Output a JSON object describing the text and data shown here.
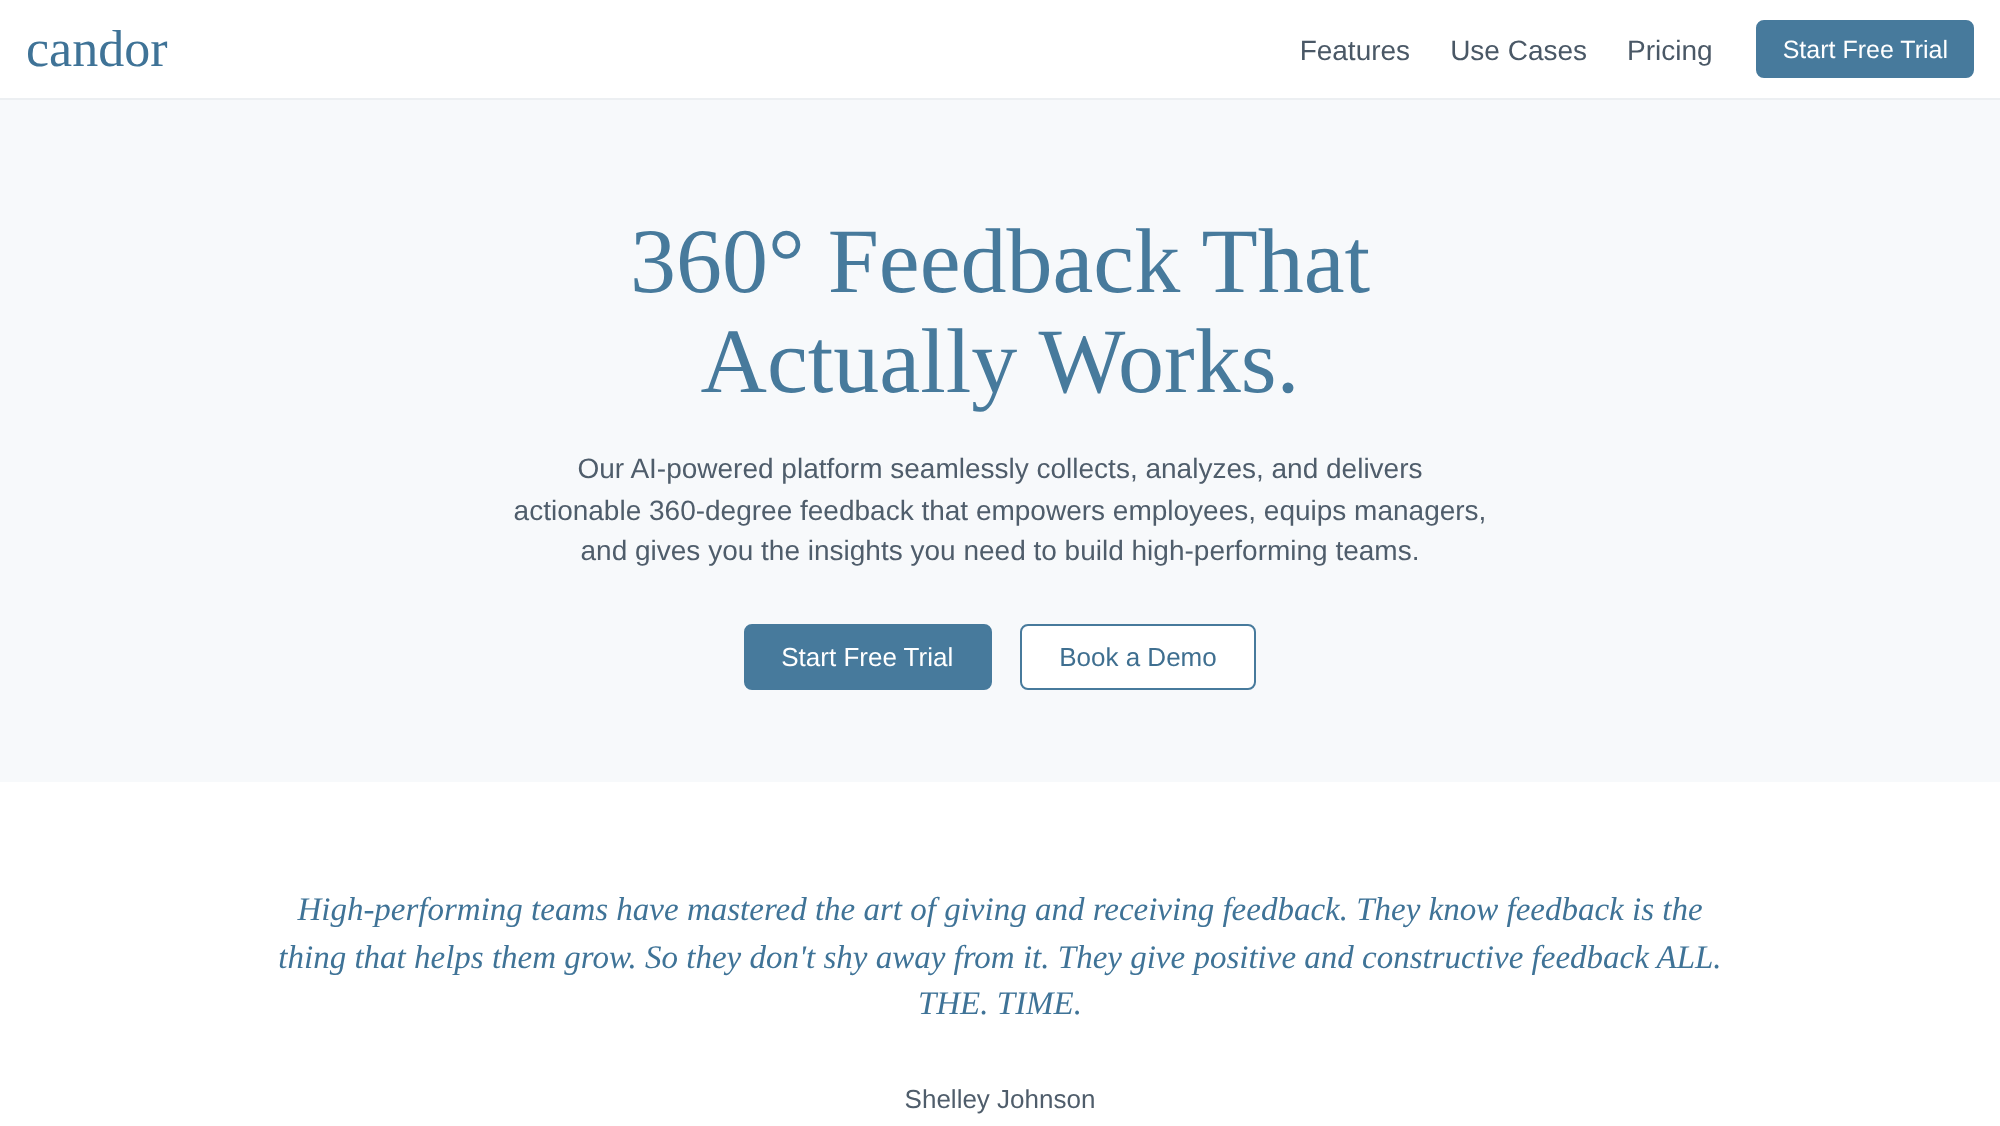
{
  "header": {
    "logo": "candor",
    "nav": [
      {
        "label": "Features"
      },
      {
        "label": "Use Cases"
      },
      {
        "label": "Pricing"
      }
    ],
    "cta": "Start Free Trial"
  },
  "hero": {
    "title": "360° Feedback That Actually Works.",
    "description": "Our AI-powered platform seamlessly collects, analyzes, and delivers actionable 360-degree feedback that empowers employees, equips managers, and gives you the insights you need to build high-performing teams.",
    "buttons": [
      {
        "label": "Start Free Trial",
        "kind": "primary"
      },
      {
        "label": "Book a Demo",
        "kind": "secondary"
      }
    ]
  },
  "testimonial": {
    "quote": "High-performing teams have mastered the art of giving and receiving feedback. They know feedback is the thing that helps them grow. So they don't shy away from it. They give positive and constructive feedback ALL. THE. TIME.",
    "author": "Shelley Johnson"
  }
}
